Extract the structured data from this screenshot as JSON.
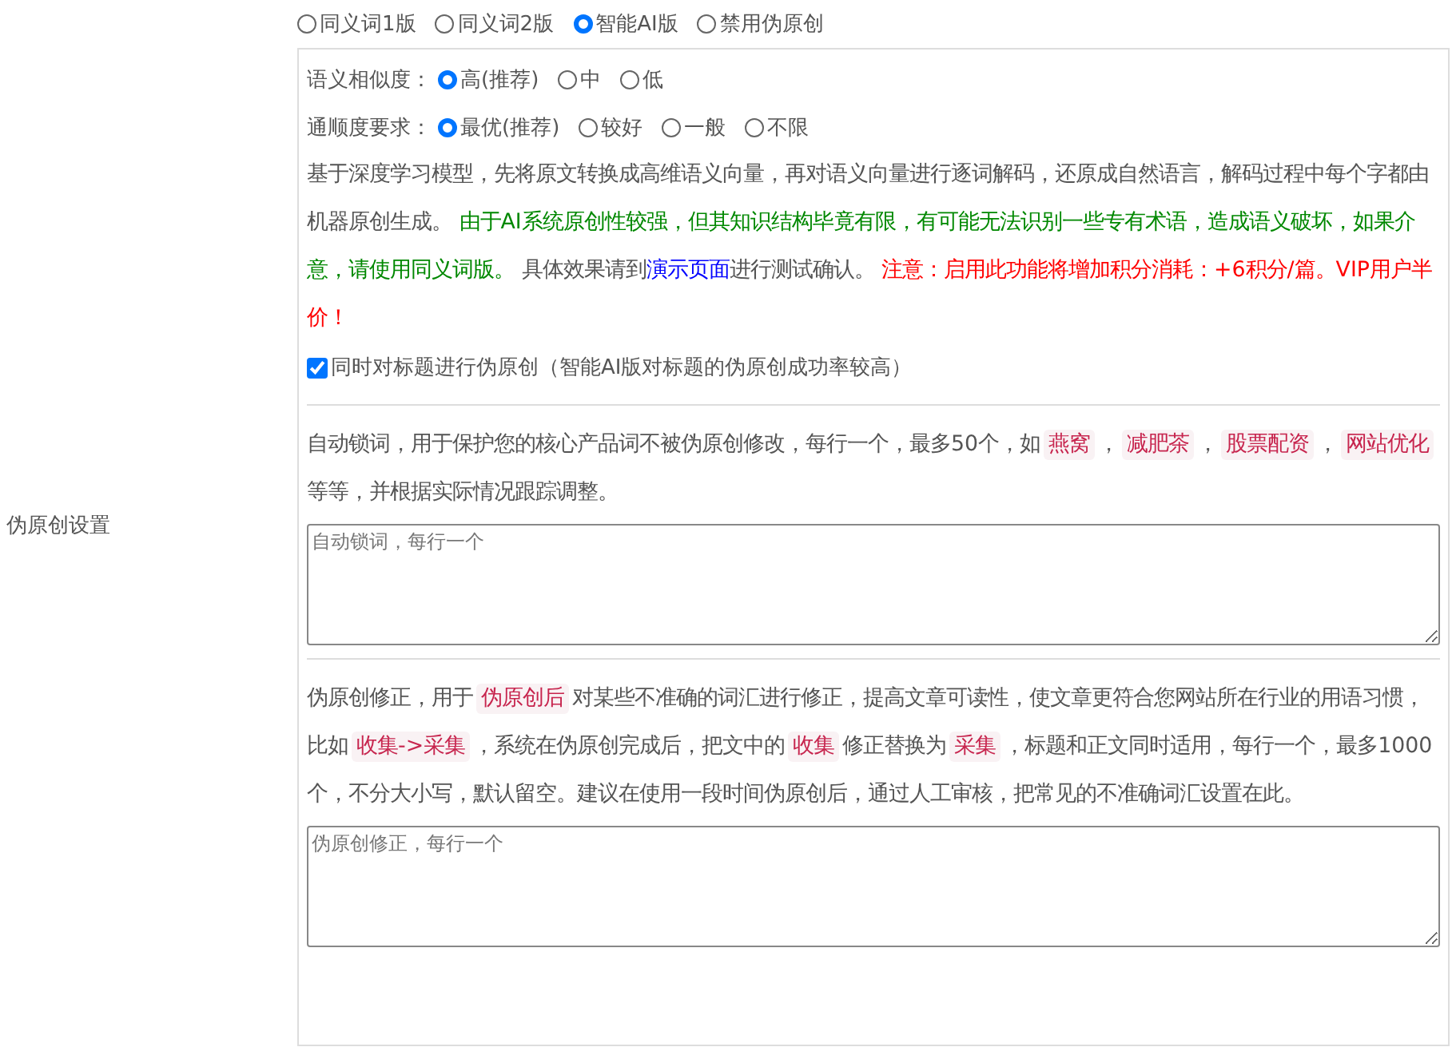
{
  "section_label": "伪原创设置",
  "modes": [
    {
      "label": "同义词1版",
      "selected": false
    },
    {
      "label": "同义词2版",
      "selected": false
    },
    {
      "label": "智能AI版",
      "selected": true
    },
    {
      "label": "禁用伪原创",
      "selected": false
    }
  ],
  "similarity": {
    "label": "语义相似度：",
    "options": [
      {
        "label": "高(推荐)",
        "selected": true
      },
      {
        "label": "中",
        "selected": false
      },
      {
        "label": "低",
        "selected": false
      }
    ]
  },
  "fluency": {
    "label": "通顺度要求：",
    "options": [
      {
        "label": "最优(推荐)",
        "selected": true
      },
      {
        "label": "较好",
        "selected": false
      },
      {
        "label": "一般",
        "selected": false
      },
      {
        "label": "不限",
        "selected": false
      }
    ]
  },
  "ai_notice": [
    {
      "kind": "plain",
      "text": "基于深度学习模型，先将原文转换成高维语义向量，再对语义向量进行逐词解码，还原成自然语言，解码过程中每个字都由机器原创生成。 "
    },
    {
      "kind": "green",
      "text": "由于AI系统原创性较强，但其知识结构毕竟有限，有可能无法识别一些专有术语，造成语义破坏，如果介意，请使用同义词版。"
    },
    {
      "kind": "plain",
      "text": " 具体效果请到"
    },
    {
      "kind": "link",
      "text": "演示页面"
    },
    {
      "kind": "plain",
      "text": "进行测试确认。 "
    },
    {
      "kind": "red",
      "text": "注意：启用此功能将增加积分消耗：+6积分/篇。VIP用户半价！"
    }
  ],
  "title_option": {
    "label": "同时对标题进行伪原创（智能AI版对标题的伪原创成功率较高）",
    "checked": true
  },
  "lock_words": {
    "description": [
      {
        "kind": "plain",
        "text": "自动锁词，用于保护您的核心产品词不被伪原创修改，每行一个，最多50个，如"
      },
      {
        "kind": "code",
        "text": "燕窝"
      },
      {
        "kind": "plain",
        "text": "，"
      },
      {
        "kind": "code",
        "text": "减肥茶"
      },
      {
        "kind": "plain",
        "text": "，"
      },
      {
        "kind": "code",
        "text": "股票配资"
      },
      {
        "kind": "plain",
        "text": "，"
      },
      {
        "kind": "code",
        "text": "网站优化"
      },
      {
        "kind": "plain",
        "text": " 等等，并根据实际情况跟踪调整。"
      }
    ],
    "placeholder": "自动锁词，每行一个"
  },
  "correction": {
    "description": [
      {
        "kind": "plain",
        "text": "伪原创修正，用于"
      },
      {
        "kind": "code",
        "text": "伪原创后"
      },
      {
        "kind": "plain",
        "text": "对某些不准确的词汇进行修正，提高文章可读性，使文章更符合您网站所在行业的用语习惯，比如"
      },
      {
        "kind": "code",
        "text": "收集->采集"
      },
      {
        "kind": "plain",
        "text": "，系统在伪原创完成后，把文中的"
      },
      {
        "kind": "code",
        "text": "收集"
      },
      {
        "kind": "plain",
        "text": "修正替换为"
      },
      {
        "kind": "code",
        "text": "采集"
      },
      {
        "kind": "plain",
        "text": "，标题和正文同时适用，每行一个，最多1000个，不分大小写，默认留空。建议在使用一段时间伪原创后，通过人工审核，把常见的不准确词汇设置在此。"
      }
    ],
    "placeholder": "伪原创修正，每行一个"
  }
}
